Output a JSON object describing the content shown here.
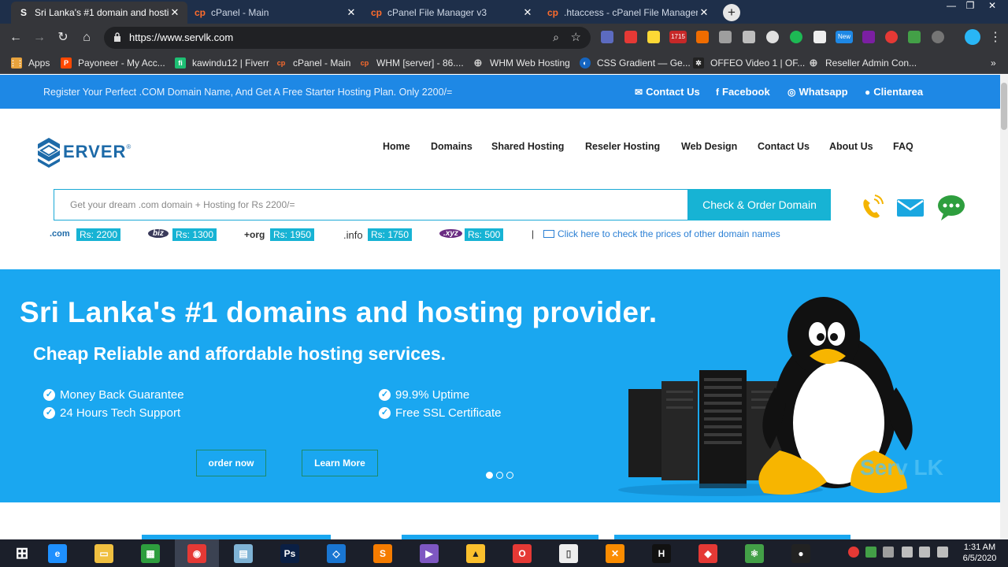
{
  "browser": {
    "tabs": [
      {
        "favicon": "S",
        "title": "Sri Lanka's #1 domain and hostin",
        "active": true
      },
      {
        "favicon": "cp",
        "title": "cPanel - Main",
        "active": false
      },
      {
        "favicon": "cp",
        "title": "cPanel File Manager v3",
        "active": false
      },
      {
        "favicon": "cp",
        "title": ".htaccess - cPanel File Manager v",
        "active": false
      }
    ],
    "url": "https://www.servlk.com",
    "extension_badge": "1715",
    "extension_badge_new": "New",
    "bookmarks": [
      {
        "label": "Apps",
        "color": "#e8a33d",
        "glyph": "⋮⋮"
      },
      {
        "label": "Payoneer - My Acc...",
        "color": "#ff4800",
        "glyph": "P"
      },
      {
        "label": "kawindu12 | Fiverr",
        "color": "#1dbf73",
        "glyph": "fi"
      },
      {
        "label": "cPanel - Main",
        "color": "#ff6c2c",
        "glyph": "cp"
      },
      {
        "label": "WHM [server] - 86....",
        "color": "#ff6c2c",
        "glyph": "cp"
      },
      {
        "label": "WHM Web Hosting",
        "color": "#9aa0a6",
        "glyph": "⊕"
      },
      {
        "label": "CSS Gradient — Ge...",
        "color": "#1565c0",
        "glyph": "◐"
      },
      {
        "label": "OFFEO Video 1 | OF...",
        "color": "#222222",
        "glyph": "✲"
      },
      {
        "label": "Reseller Admin Con...",
        "color": "#9aa0a6",
        "glyph": "⊕"
      }
    ]
  },
  "topbar": {
    "promo": "Register Your Perfect .COM Domain Name, And Get A Free Starter Hosting Plan. Only 2200/=",
    "links": [
      {
        "icon": "envelope-icon",
        "glyph": "✉",
        "label": "Contact Us"
      },
      {
        "icon": "facebook-icon",
        "glyph": "f",
        "label": "Facebook"
      },
      {
        "icon": "whatsapp-icon",
        "glyph": "◎",
        "label": "Whatsapp"
      },
      {
        "icon": "user-icon",
        "glyph": "●",
        "label": "Clientarea"
      }
    ]
  },
  "logo": {
    "text": "ERVER",
    "reg": "®"
  },
  "nav": [
    "Home",
    "Domains",
    "Shared Hosting",
    "Reseler Hosting",
    "Web Design",
    "Contact Us",
    "About Us",
    "FAQ"
  ],
  "search": {
    "placeholder": "Get your dream .com domain + Hosting for Rs 2200/=",
    "button": "Check & Order Domain"
  },
  "prices": [
    {
      "tld": ".com",
      "price": "Rs: 2200"
    },
    {
      "tld": "biz",
      "price": "Rs: 1300"
    },
    {
      "tld": "+org",
      "price": "Rs: 1950"
    },
    {
      "tld": ".info",
      "price": "Rs: 1750"
    },
    {
      "tld": ".xyz",
      "price": "Rs: 500"
    }
  ],
  "prices_separator": "|",
  "other_prices_link": "Click here to check the prices of other domain names",
  "hero": {
    "title": "Sri Lanka's #1 domains and hosting provider.",
    "subtitle": "Cheap Reliable and affordable hosting services.",
    "features": [
      "Money Back Guarantee",
      "24 Hours Tech Support",
      "99.9% Uptime",
      "Free SSL Certificate"
    ],
    "order_button": "order now",
    "learn_button": "Learn More",
    "watermark": "Serv LK",
    "slides": 3,
    "active_slide": 1
  },
  "colors": {
    "topbar": "#1e88e5",
    "hero": "#1aa7f0",
    "accent": "#17b3d4"
  },
  "taskbar": {
    "apps": [
      {
        "name": "start-icon",
        "color": "transparent",
        "glyph": "⊞"
      },
      {
        "name": "internet-explorer-icon",
        "color": "#1e90ff",
        "glyph": "e"
      },
      {
        "name": "file-explorer-icon",
        "color": "#f0c040",
        "glyph": "▭"
      },
      {
        "name": "store-icon",
        "color": "#2e9e3e",
        "glyph": "▦"
      },
      {
        "name": "chrome-icon",
        "color": "#e53935",
        "glyph": "◉"
      },
      {
        "name": "notepad-icon",
        "color": "#7fb3d5",
        "glyph": "▤"
      },
      {
        "name": "photoshop-icon",
        "color": "#0a1f44",
        "glyph": "Ps"
      },
      {
        "name": "vscode-icon",
        "color": "#1976d2",
        "glyph": "◇"
      },
      {
        "name": "sublime-icon",
        "color": "#f57c00",
        "glyph": "S"
      },
      {
        "name": "visual-studio-icon",
        "color": "#7e57c2",
        "glyph": "▶"
      },
      {
        "name": "nvda-icon",
        "color": "#fbc02d",
        "glyph": "▲"
      },
      {
        "name": "opera-icon",
        "color": "#e53935",
        "glyph": "O"
      },
      {
        "name": "document-icon",
        "color": "#eeeeee",
        "glyph": "▯"
      },
      {
        "name": "xampp-icon",
        "color": "#fb8c00",
        "glyph": "✕"
      },
      {
        "name": "h-app-icon",
        "color": "#111111",
        "glyph": "H"
      },
      {
        "name": "git-icon",
        "color": "#e53935",
        "glyph": "◆"
      },
      {
        "name": "atom-icon",
        "color": "#43a047",
        "glyph": "⚛"
      },
      {
        "name": "record-icon",
        "color": "#222222",
        "glyph": "●"
      }
    ],
    "time": "1:31 AM",
    "date": "6/5/2020"
  }
}
